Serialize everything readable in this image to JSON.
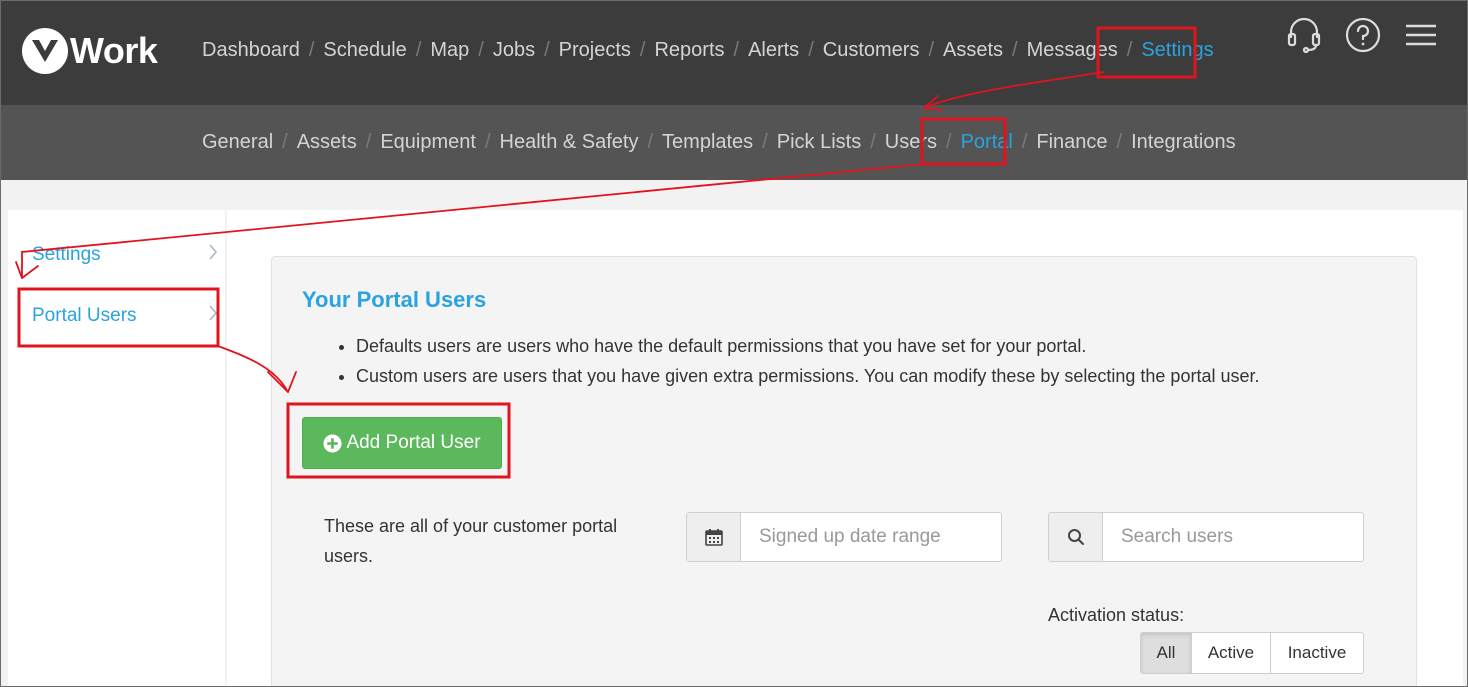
{
  "logo": {
    "text": "Work",
    "letter": "v"
  },
  "main_nav": [
    {
      "label": "Dashboard"
    },
    {
      "label": "Schedule"
    },
    {
      "label": "Map"
    },
    {
      "label": "Jobs"
    },
    {
      "label": "Projects"
    },
    {
      "label": "Reports"
    },
    {
      "label": "Alerts"
    },
    {
      "label": "Customers"
    },
    {
      "label": "Assets"
    },
    {
      "label": "Messages"
    },
    {
      "label": "Settings",
      "active": true
    }
  ],
  "header_icons": [
    "headset-icon",
    "help-icon",
    "menu-icon"
  ],
  "sub_nav": [
    {
      "label": "General"
    },
    {
      "label": "Assets"
    },
    {
      "label": "Equipment"
    },
    {
      "label": "Health & Safety"
    },
    {
      "label": "Templates"
    },
    {
      "label": "Pick Lists"
    },
    {
      "label": "Users"
    },
    {
      "label": "Portal",
      "active": true
    },
    {
      "label": "Finance"
    },
    {
      "label": "Integrations"
    }
  ],
  "sidebar": {
    "items": [
      {
        "label": "Settings"
      },
      {
        "label": "Portal Users"
      }
    ]
  },
  "panel": {
    "title": "Your Portal Users",
    "bullets": [
      "Defaults users are users who have the default permissions that you have set for your portal.",
      "Custom users are users that you have given extra permissions. You can modify these by selecting the portal user."
    ],
    "add_button": "Add Portal User",
    "description": "These are all of your customer portal users.",
    "date_range_placeholder": "Signed up date range",
    "search_placeholder": "Search users",
    "activation_label": "Activation status:",
    "activation_options": [
      "All",
      "Active",
      "Inactive"
    ]
  },
  "colors": {
    "topbar": "#3c3c3c",
    "subbar": "#545454",
    "accent": "#2aa3de",
    "button_green": "#5cb85c",
    "annotation_red": "#e0141e"
  }
}
